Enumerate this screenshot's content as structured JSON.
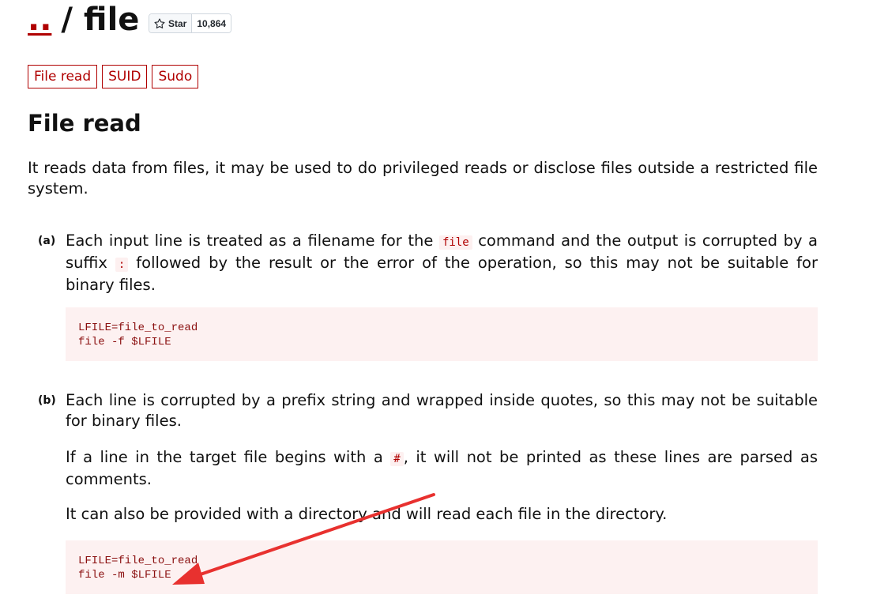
{
  "header": {
    "parent_link": "..",
    "title": "/ file",
    "star": {
      "label": "Star",
      "count": "10,864"
    }
  },
  "tags": [
    "File read",
    "SUID",
    "Sudo"
  ],
  "section": {
    "title": "File read",
    "intro": "It reads data from files, it may be used to do privileged reads or disclose files outside a restricted file system."
  },
  "items": {
    "a": {
      "label": "(a)",
      "text_before": "Each input line is treated as a filename for the ",
      "code1": "file",
      "text_mid": " command and the output is corrupted by a suffix ",
      "code2": ":",
      "text_after": " followed by the result or the error of the operation, so this may not be suitable for binary files.",
      "code_lines": [
        "LFILE=file_to_read",
        "file -f $LFILE"
      ]
    },
    "b": {
      "label": "(b)",
      "p1": "Each line is corrupted by a prefix string and wrapped inside quotes, so this may not be suitable for binary files.",
      "p2_before": "If a line in the target file begins with a ",
      "p2_code": "#",
      "p2_after": ", it will not be printed as these lines are parsed as comments.",
      "p3": "It can also be provided with a directory and will read each file in the directory.",
      "code_lines": [
        "LFILE=file_to_read",
        "file -m $LFILE"
      ]
    }
  },
  "colors": {
    "accent": "#b00000",
    "code_bg": "#fdf1f1",
    "annotation_arrow": "#e8312f"
  }
}
